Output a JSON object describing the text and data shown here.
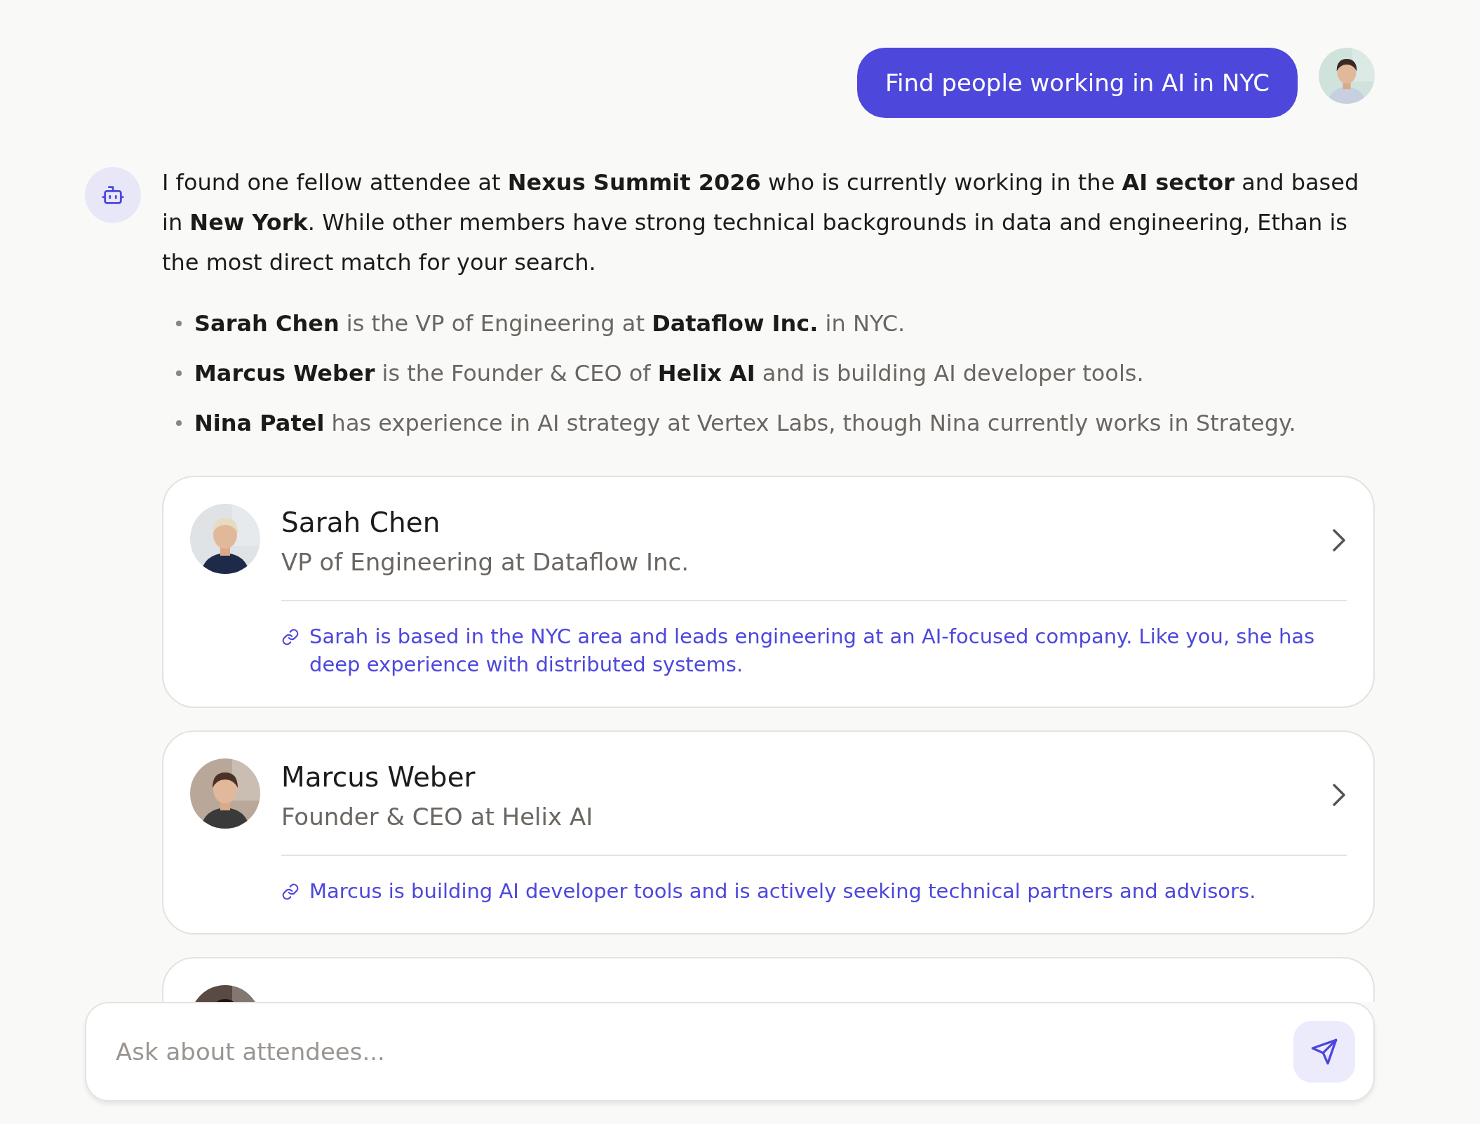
{
  "user_message": {
    "text": "Find people working in AI in NYC"
  },
  "assistant": {
    "intro": "I found one fellow attendee at **Nexus Summit 2026** who is currently working in the **AI sector** and based in **New York**. While other members have strong technical backgrounds in data and engineering, Ethan is the most direct match for your search.",
    "bullets": [
      "**Sarah Chen** is the VP of Engineering at **Dataflow Inc.** in NYC.",
      "**Marcus Weber** is the Founder & CEO of **Helix AI** and is building AI developer tools.",
      "**Nina Patel** has experience in AI strategy at Vertex Labs, though Nina currently works in Strategy."
    ],
    "cards": [
      {
        "kind": "full",
        "name": "Sarah Chen",
        "title": "VP of Engineering at Dataflow Inc.",
        "reason": "Sarah is based in the NYC area and leads engineering at an AI-focused company. Like you, she has deep experience with distributed systems."
      },
      {
        "kind": "full",
        "name": "Marcus Weber",
        "title": "Founder & CEO at Helix AI",
        "reason": "Marcus is building AI developer tools and is actively seeking technical partners and advisors."
      },
      {
        "kind": "cut"
      }
    ]
  },
  "composer": {
    "placeholder": "Ask about attendees..."
  }
}
